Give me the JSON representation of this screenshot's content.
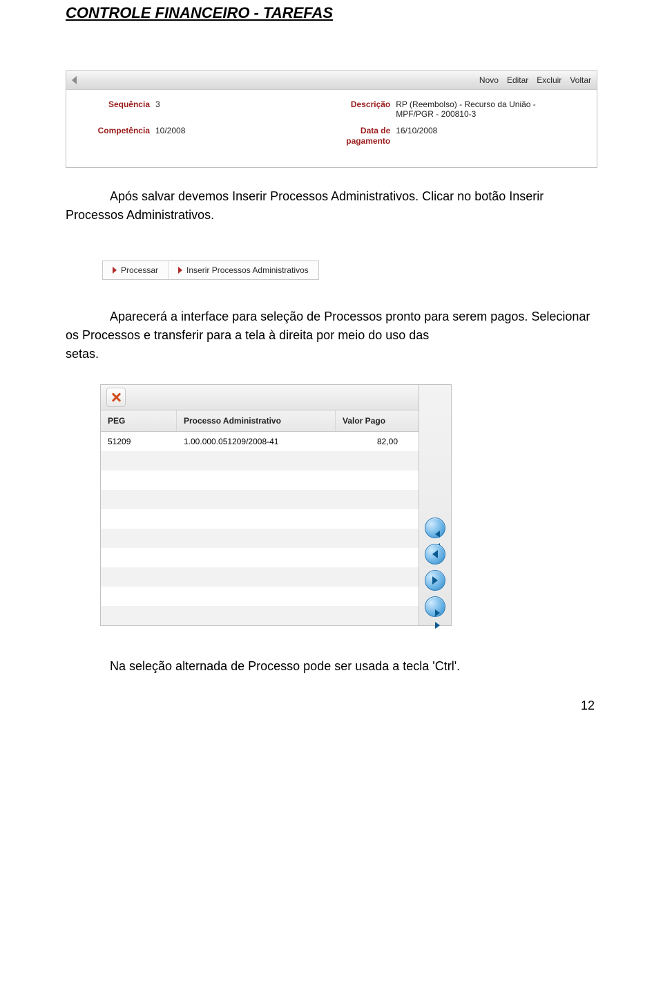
{
  "title": "CONTROLE FINANCEIRO - TAREFAS",
  "screenshot1": {
    "actions": [
      "Novo",
      "Editar",
      "Excluir",
      "Voltar"
    ],
    "fields": {
      "sequencia_label": "Sequência",
      "sequencia_value": "3",
      "descricao_label": "Descrição",
      "descricao_value": "RP (Reembolso) - Recurso da União - MPF/PGR - 200810-3",
      "competencia_label": "Competência",
      "competencia_value": "10/2008",
      "data_pagamento_label": "Data de pagamento",
      "data_pagamento_value": "16/10/2008"
    }
  },
  "paragraph1": "Após salvar devemos Inserir Processos Administrativos. Clicar no botão Inserir Processos Administrativos.",
  "actionbar2": {
    "processar": "Processar",
    "inserir": "Inserir Processos Administrativos"
  },
  "setas_label": "setas.",
  "paragraph2": "Aparecerá a interface para seleção de Processos pronto para serem pagos. Selecionar os Processos e transferir para a tela à direita por meio do uso das",
  "table": {
    "headers": {
      "peg": "PEG",
      "pa": "Processo Administrativo",
      "vp": "Valor Pago"
    },
    "rows": [
      {
        "peg": "51209",
        "pa": "1.00.000.051209/2008-41",
        "vp": "82,00"
      }
    ],
    "empty_rows": 9
  },
  "paragraph3": "Na seleção alternada de Processo pode ser usada a tecla 'Ctrl'.",
  "page_number": "12"
}
